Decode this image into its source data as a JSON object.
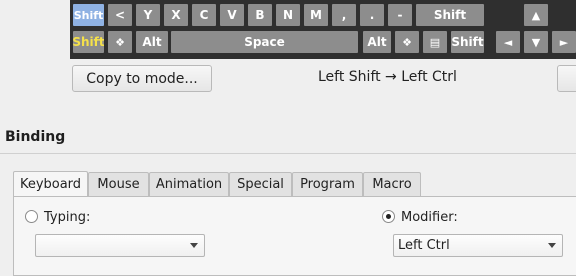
{
  "keyboard": {
    "row1": [
      {
        "name": "key-left-shift",
        "label": "Shift",
        "selected": true
      },
      {
        "name": "key-less-than",
        "label": "<"
      },
      {
        "name": "key-y",
        "label": "Y"
      },
      {
        "name": "key-x",
        "label": "X"
      },
      {
        "name": "key-c",
        "label": "C"
      },
      {
        "name": "key-v",
        "label": "V"
      },
      {
        "name": "key-b",
        "label": "B"
      },
      {
        "name": "key-n",
        "label": "N"
      },
      {
        "name": "key-m",
        "label": "M"
      },
      {
        "name": "key-comma",
        "label": ","
      },
      {
        "name": "key-period",
        "label": "."
      },
      {
        "name": "key-minus",
        "label": "-"
      },
      {
        "name": "key-right-shift",
        "label": "Shift"
      },
      {
        "name": "key-arrow-up",
        "label": "▲"
      }
    ],
    "row2": [
      {
        "name": "key-left-ctrl",
        "label": "Shift",
        "highlight": true
      },
      {
        "name": "key-left-super",
        "label": "❖"
      },
      {
        "name": "key-left-alt",
        "label": "Alt"
      },
      {
        "name": "key-space",
        "label": "Space"
      },
      {
        "name": "key-right-alt",
        "label": "Alt"
      },
      {
        "name": "key-right-super",
        "label": "❖"
      },
      {
        "name": "key-menu",
        "label": "▤"
      },
      {
        "name": "key-right-ctrl",
        "label": "Shift"
      },
      {
        "name": "key-arrow-left",
        "label": "◄"
      },
      {
        "name": "key-arrow-down",
        "label": "▼"
      },
      {
        "name": "key-arrow-right",
        "label": "►"
      }
    ]
  },
  "mode_row": {
    "copy_button": "Copy to mode...",
    "mapping_text": "Left Shift → Left Ctrl"
  },
  "binding": {
    "title": "Binding",
    "tabs": [
      "Keyboard",
      "Mouse",
      "Animation",
      "Special",
      "Program",
      "Macro"
    ],
    "active_tab": "Keyboard",
    "typing_label": "Typing:",
    "typing_value": "",
    "modifier_label": "Modifier:",
    "modifier_value": "Left Ctrl",
    "modifier_checked": true
  },
  "colors": {
    "keyboard_bg": "#2f2f2f",
    "key": "#8d8d8d",
    "key_selected": "#8fb2e3",
    "key_highlight_text": "#f5e14a"
  }
}
